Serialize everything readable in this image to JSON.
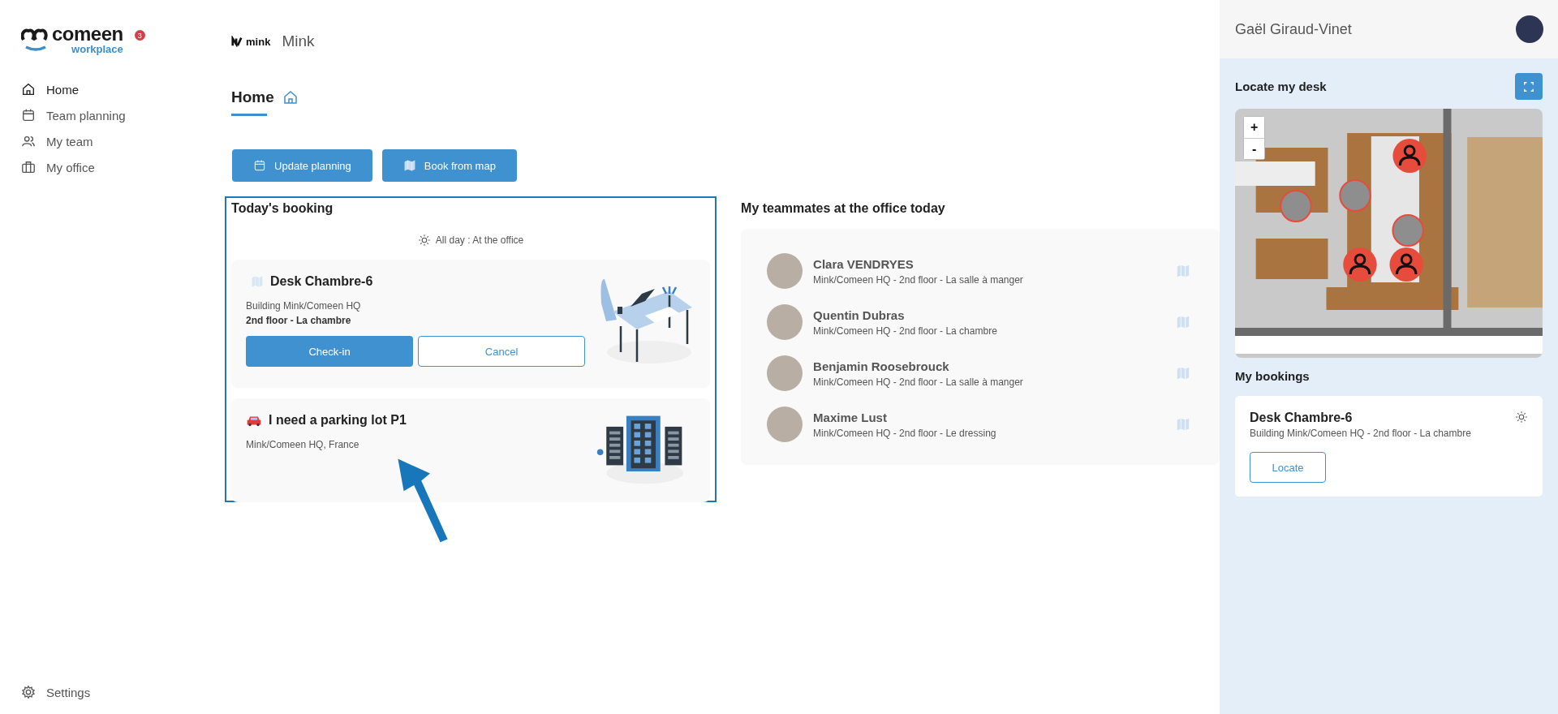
{
  "brand": {
    "name": "comeen",
    "tagline": "workplace",
    "badge": "3"
  },
  "nav": [
    {
      "label": "Home",
      "kind": "home",
      "selected": true
    },
    {
      "label": "Team planning",
      "kind": "calendar",
      "selected": false
    },
    {
      "label": "My team",
      "kind": "people",
      "selected": false
    },
    {
      "label": "My office",
      "kind": "briefcase",
      "selected": false
    }
  ],
  "settings": {
    "label": "Settings"
  },
  "org": {
    "logo_text": "mink",
    "name": "Mink"
  },
  "page_tabs": [
    {
      "label": "Home",
      "selected": true
    }
  ],
  "actions": [
    {
      "label": "Update planning",
      "kind": "calendar"
    },
    {
      "label": "Book from map",
      "kind": "map"
    }
  ],
  "todays_booking": {
    "title": "Today's booking",
    "period": "All day : At the office",
    "bookings": [
      {
        "kind": "desk",
        "title": "Desk Chambre-6",
        "line1": "Building Mink/Comeen HQ",
        "line2": "2nd floor - La chambre",
        "buttons": [
          "Check-in",
          "Cancel"
        ]
      },
      {
        "kind": "parking",
        "title": "I need a parking lot P1",
        "line1": "Mink/Comeen HQ, France"
      }
    ]
  },
  "teammates": {
    "title": "My teammates at the office today",
    "people": [
      {
        "name": "Clara VENDRYES",
        "location": "Mink/Comeen HQ - 2nd floor - La salle à manger"
      },
      {
        "name": "Quentin Dubras",
        "location": "Mink/Comeen HQ - 2nd floor - La chambre"
      },
      {
        "name": "Benjamin Roosebrouck",
        "location": "Mink/Comeen HQ - 2nd floor - La salle à manger"
      },
      {
        "name": "Maxime Lust",
        "location": "Mink/Comeen HQ - 2nd floor - Le dressing"
      }
    ]
  },
  "user": {
    "name": "Gaël Giraud-Vinet"
  },
  "locate": {
    "title": "Locate my desk",
    "zoom_in": "+",
    "zoom_out": "-"
  },
  "my_bookings": {
    "title": "My bookings",
    "items": [
      {
        "title": "Desk Chambre-6",
        "location": "Building Mink/Comeen HQ - 2nd floor - La chambre",
        "button": "Locate"
      }
    ]
  }
}
